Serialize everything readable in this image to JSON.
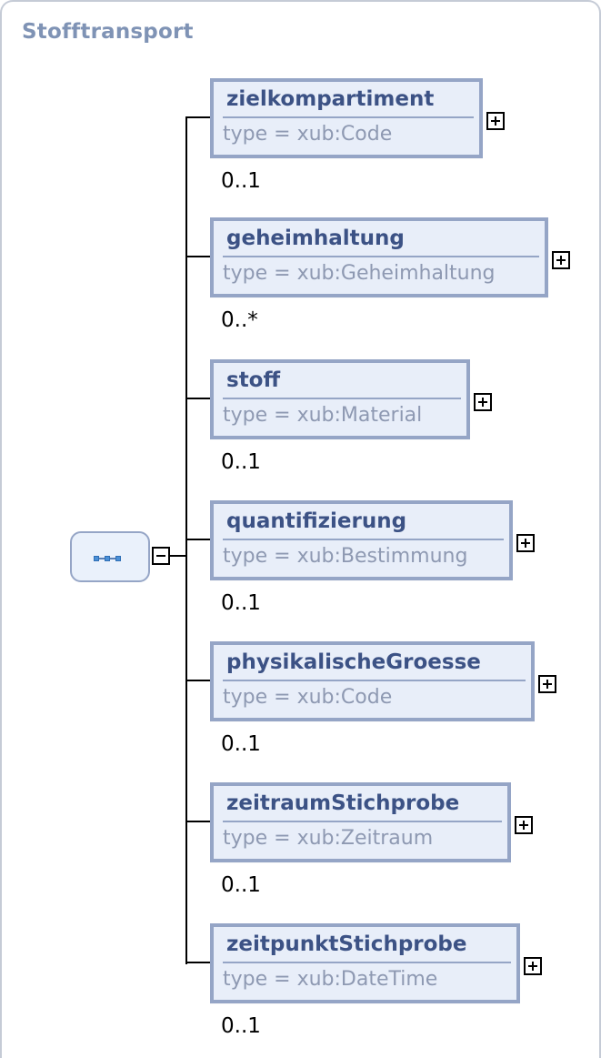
{
  "title": "Stofftransport",
  "elements": [
    {
      "name": "zielkompartiment",
      "type": "type = xub:Code",
      "cardinality": "0..1"
    },
    {
      "name": "geheimhaltung",
      "type": "type = xub:Geheimhaltung",
      "cardinality": "0..*"
    },
    {
      "name": "stoff",
      "type": "type = xub:Material",
      "cardinality": "0..1"
    },
    {
      "name": "quantifizierung",
      "type": "type = xub:Bestimmung",
      "cardinality": "0..1"
    },
    {
      "name": "physikalischeGroesse",
      "type": "type = xub:Code",
      "cardinality": "0..1"
    },
    {
      "name": "zeitraumStichprobe",
      "type": "type = xub:Zeitraum",
      "cardinality": "0..1"
    },
    {
      "name": "zeitpunktStichprobe",
      "type": "type = xub:DateTime",
      "cardinality": "0..1"
    }
  ],
  "icons": {
    "sequence": "sequence-compositor-icon",
    "collapse": "minus-icon",
    "expand": "plus-icon"
  },
  "colors": {
    "title": "#7f93b5",
    "element_border": "#95a5c6",
    "element_fill": "#e8eef9",
    "element_name": "#3c5285",
    "type_text": "#8e99b2",
    "connector": "#000000"
  }
}
